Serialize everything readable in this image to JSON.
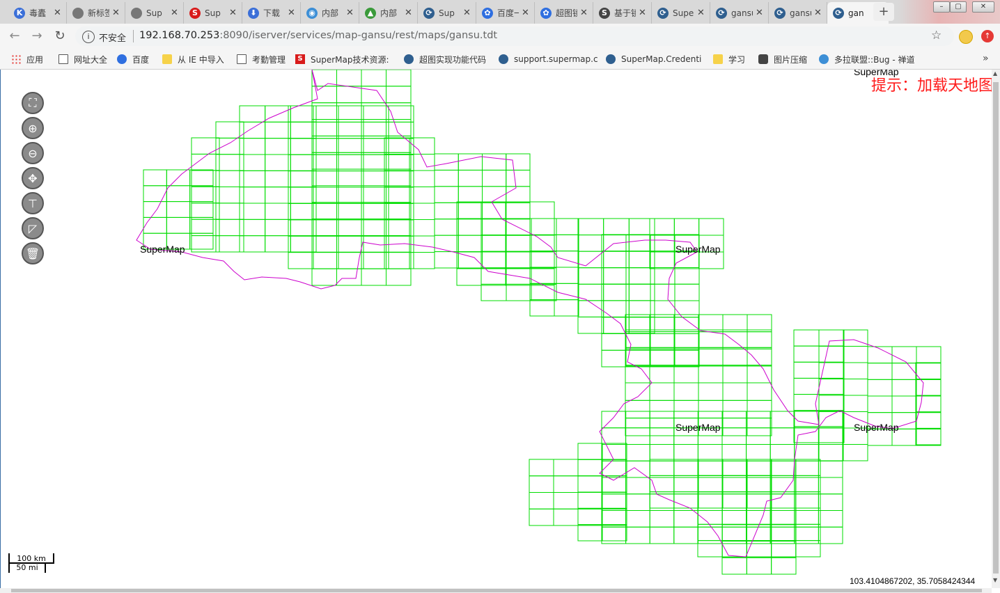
{
  "browser": {
    "tabs": [
      {
        "label": "毒蠹",
        "icon": "K",
        "color": "#3b6fd8"
      },
      {
        "label": "新标签页",
        "icon": "",
        "color": "#777"
      },
      {
        "label": "Sup",
        "icon": "",
        "color": "#777"
      },
      {
        "label": "Sup",
        "icon": "S",
        "color": "#d81b1b"
      },
      {
        "label": "下载",
        "icon": "⬇",
        "color": "#3b6fd8"
      },
      {
        "label": "内部",
        "icon": "◉",
        "color": "#3d8fd6"
      },
      {
        "label": "内部",
        "icon": "▲",
        "color": "#3a9a3a"
      },
      {
        "label": "Sup",
        "icon": "⟳",
        "color": "#2f5f8f"
      },
      {
        "label": "百度一下",
        "icon": "✿",
        "color": "#2f6fe0"
      },
      {
        "label": "超图镜像",
        "icon": "✿",
        "color": "#2f6fe0"
      },
      {
        "label": "基于镜像",
        "icon": "S",
        "color": "#444"
      },
      {
        "label": "SuperM",
        "icon": "⟳",
        "color": "#2f5f8f"
      },
      {
        "label": "gansu彩",
        "icon": "⟳",
        "color": "#2f5f8f"
      },
      {
        "label": "gansu彩",
        "icon": "⟳",
        "color": "#2f5f8f"
      },
      {
        "label": "gan",
        "icon": "⟳",
        "color": "#2f5f8f",
        "active": true
      }
    ],
    "new_tab": "+",
    "window_controls": [
      "–",
      "▢",
      "✕"
    ],
    "nav": {
      "back": "←",
      "forward": "→",
      "reload": "↻"
    },
    "address": {
      "security_label": "不安全",
      "url_host": "192.168.70.253",
      "url_rest": ":8090/iserver/services/map-gansu/rest/maps/gansu.tdt"
    },
    "star": "☆",
    "bookmarks": [
      {
        "label": "应用",
        "icon": "grid"
      },
      {
        "label": "网址大全",
        "icon": "page"
      },
      {
        "label": "百度",
        "icon": "paw"
      },
      {
        "label": "从 IE 中导入",
        "icon": "folder"
      },
      {
        "label": "考勤管理",
        "icon": "page"
      },
      {
        "label": "SuperMap技术资源:",
        "icon": "sred"
      },
      {
        "label": "超图实现功能代码",
        "icon": "spin"
      },
      {
        "label": "support.supermap.c",
        "icon": "spin"
      },
      {
        "label": "SuperMap.Credenti",
        "icon": "spin"
      },
      {
        "label": "学习",
        "icon": "folder"
      },
      {
        "label": "图片压缩",
        "icon": "pic"
      },
      {
        "label": "多拉联盟::Bug - 禅道",
        "icon": "globe"
      }
    ],
    "bookmarks_more": "»"
  },
  "map": {
    "tip_text": "提示：加载天地图",
    "watermark": "SuperMap",
    "tile_labels": [
      "SuperMap",
      "SuperMap",
      "SuperMap",
      "SuperMap",
      "SuperMap"
    ],
    "controls": [
      {
        "name": "zoom-to-extent",
        "icon": "⛶"
      },
      {
        "name": "zoom-in",
        "icon": "⊕"
      },
      {
        "name": "zoom-out",
        "icon": "⊖"
      },
      {
        "name": "pan",
        "icon": "✥"
      },
      {
        "name": "measure-distance",
        "icon": "⊤"
      },
      {
        "name": "measure-area",
        "icon": "◸"
      },
      {
        "name": "clear",
        "icon": "🗑"
      }
    ],
    "scale": {
      "top": "100 km",
      "bottom": "50 mi"
    },
    "coordinates": "103.4104867202, 35.7058424344",
    "colors": {
      "tile_grid": "#00dd00",
      "boundary": "#cc00cc",
      "tip": "#ff1a1a"
    }
  }
}
